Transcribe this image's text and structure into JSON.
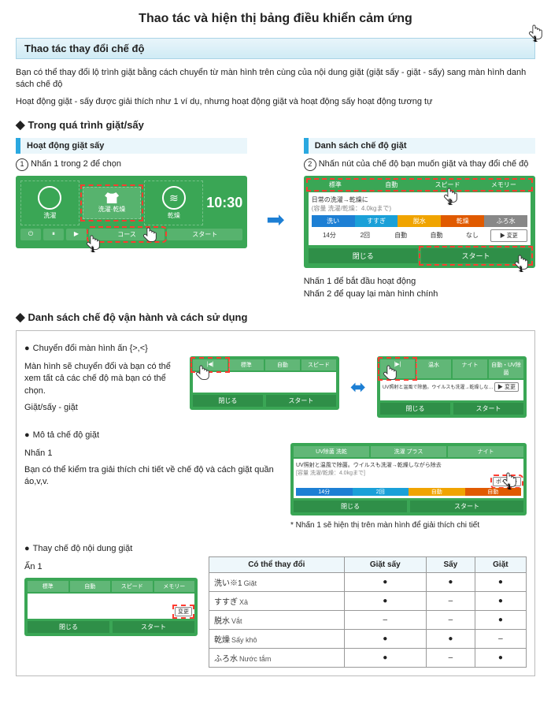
{
  "title": "Thao tác và hiện thị bảng điều khiển cảm ứng",
  "section1": "Thao tác thay đổi chế độ",
  "intro1": "Bạn có thể thay đổi lộ trình giặt bằng cách chuyển từ màn hình trên cùng của nội dung giặt (giặt sấy - giặt - sấy) sang màn hình danh sách chế độ",
  "intro2": "Hoạt động giặt - sấy được giải thích như 1 ví dụ, nhưng hoạt động giặt và hoạt động sấy hoạt động tương tự",
  "h2a": "Trong quá trình giặt/sấy",
  "left": {
    "title": "Hoạt động giặt sấy",
    "step": "Nhấn 1 trong 2 để chọn",
    "opts": [
      "洗濯",
      "洗濯·乾燥",
      "乾燥"
    ],
    "time": "10:30",
    "btm": [
      "コース",
      "スタート"
    ]
  },
  "right": {
    "title": "Danh sách  chế độ giặt",
    "step": "Nhấn nút của chế độ bạn muốn giặt và thay đổi chế độ",
    "tabs": [
      "標準",
      "自動",
      "スピード",
      "メモリー"
    ],
    "desc": "日常の洗濯→乾燥に",
    "sub": "(容量 洗濯/乾燥：4.0kgまで)",
    "bars": [
      "洗い",
      "すすぎ",
      "脱水",
      "乾燥",
      "ふろ水"
    ],
    "barcolors": [
      "#1d7fd4",
      "#1aa0d8",
      "#f0a400",
      "#e05a00",
      "#888"
    ],
    "vals": [
      "14分",
      "2回",
      "自動",
      "自動",
      "なし"
    ],
    "chg": "▶ 変更",
    "btns": [
      "閉じる",
      "スタート"
    ],
    "note1": "Nhấn 1 để bắt đầu hoạt động",
    "note2": "Nhấn 2 để quay lại màn hình chính"
  },
  "h2b": "Danh sách chế độ vận hành và cách sử dụng",
  "sec_a": {
    "title": "Chuyển đổi màn hình ấn {>,<}",
    "text1": "Màn hình sẽ chuyển đổi và bạn có thể xem tất cả các chế độ mà bạn có thể chọn.",
    "text2": "Giặt/sấy - giặt"
  },
  "sec_b": {
    "title": "Mô tả chế độ giặt",
    "sub": "Nhấn 1",
    "text": "Bạn có thể kiểm tra giải thích chi tiết về chế độ và cách giặt quần áo,v,v.",
    "tabs": [
      "UV除菌 洗乾",
      "洗濯 プラス",
      "ナイト"
    ],
    "desc": "UV照射と温風で除菌。ウイルスも洗濯→乾燥しながら除去",
    "sub2": "[容量 洗濯/乾燥：4.0kgまで]",
    "btn": "ポイント",
    "note": "* Nhấn 1 sẽ hiện thị trên màn hình để giải thích chi tiết"
  },
  "sec_c": {
    "title": "Thay chế độ nội dung giặt",
    "sub": "Ấn 1",
    "chg": "変更"
  },
  "table": {
    "headers": [
      "Có thể thay đổi",
      "Giặt sấy",
      "Sấy",
      "Giặt"
    ],
    "rows": [
      {
        "jp": "洗い※1",
        "vi": "Giặt",
        "v": [
          "●",
          "●",
          "●"
        ]
      },
      {
        "jp": "すすぎ",
        "vi": "Xả",
        "v": [
          "●",
          "–",
          "●"
        ]
      },
      {
        "jp": "脱水",
        "vi": "Vắt",
        "v": [
          "–",
          "–",
          "●"
        ]
      },
      {
        "jp": "乾燥",
        "vi": "Sấy khô",
        "v": [
          "●",
          "●",
          "–"
        ]
      },
      {
        "jp": "ふろ水",
        "vi": "Nước tắm",
        "v": [
          "●",
          "–",
          "●"
        ]
      }
    ]
  }
}
